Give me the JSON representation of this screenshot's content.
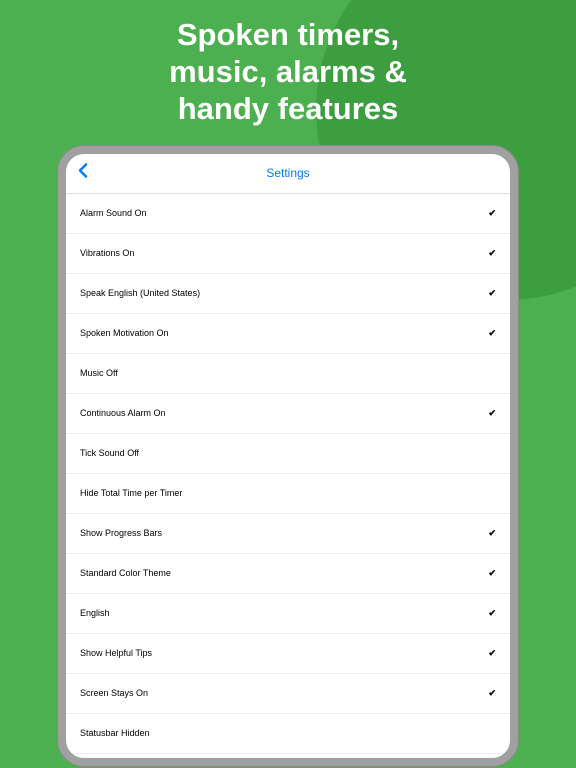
{
  "marketing": {
    "headline_line1": "Spoken timers,",
    "headline_line2": "music, alarms &",
    "headline_line3": "handy features"
  },
  "nav": {
    "title": "Settings"
  },
  "settings": [
    {
      "label": "Alarm Sound On",
      "checked": true
    },
    {
      "label": "Vibrations On",
      "checked": true
    },
    {
      "label": "Speak English (United States)",
      "checked": true
    },
    {
      "label": "Spoken Motivation On",
      "checked": true
    },
    {
      "label": "Music Off",
      "checked": false
    },
    {
      "label": "Continuous Alarm On",
      "checked": true
    },
    {
      "label": "Tick Sound Off",
      "checked": false
    },
    {
      "label": "Hide Total Time per Timer",
      "checked": false
    },
    {
      "label": "Show Progress Bars",
      "checked": true
    },
    {
      "label": "Standard Color Theme",
      "checked": true
    },
    {
      "label": "English",
      "checked": true
    },
    {
      "label": "Show Helpful Tips",
      "checked": true
    },
    {
      "label": "Screen Stays On",
      "checked": true
    },
    {
      "label": "Statusbar Hidden",
      "checked": false
    }
  ]
}
